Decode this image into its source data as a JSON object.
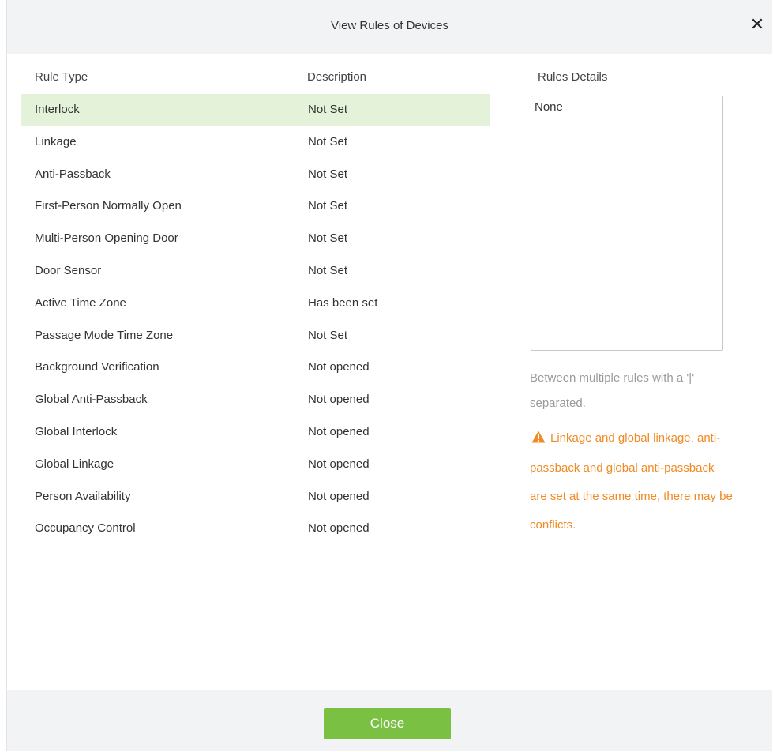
{
  "dialog": {
    "title": "View Rules of Devices",
    "close_icon": "close-icon"
  },
  "table": {
    "headers": {
      "rule_type": "Rule Type",
      "description": "Description"
    },
    "rows": [
      {
        "rule": "Interlock",
        "description": "Not Set",
        "selected": true
      },
      {
        "rule": "Linkage",
        "description": "Not Set"
      },
      {
        "rule": "Anti-Passback",
        "description": "Not Set"
      },
      {
        "rule": "First-Person Normally Open",
        "description": "Not Set"
      },
      {
        "rule": "Multi-Person Opening Door",
        "description": "Not Set"
      },
      {
        "rule": "Door Sensor",
        "description": "Not Set"
      },
      {
        "rule": "Active Time Zone",
        "description": "Has been set"
      },
      {
        "rule": "Passage Mode Time Zone",
        "description": "Not Set"
      },
      {
        "rule": "Background Verification",
        "description": "Not opened"
      },
      {
        "rule": "Global Anti-Passback",
        "description": "Not opened"
      },
      {
        "rule": "Global Interlock",
        "description": "Not opened"
      },
      {
        "rule": "Global Linkage",
        "description": "Not opened"
      },
      {
        "rule": "Person Availability",
        "description": "Not opened"
      },
      {
        "rule": "Occupancy Control",
        "description": "Not opened"
      }
    ]
  },
  "details": {
    "label": "Rules Details",
    "value": "None",
    "hint": "Between multiple rules with a '|' separated.",
    "warning": "Linkage and global linkage, anti-passback and global anti-passback are set at the same time, there may be conflicts.",
    "warning_icon": "warning-icon"
  },
  "footer": {
    "close_label": "Close"
  },
  "colors": {
    "accent": "#7ac143",
    "selected_row": "#e3f2d9",
    "warning": "#f08a24",
    "header_bg": "#f2f3f5"
  }
}
